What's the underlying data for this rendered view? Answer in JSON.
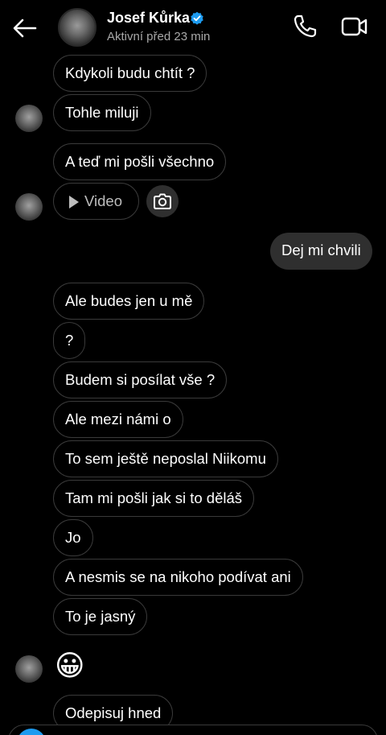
{
  "header": {
    "contact_name": "Josef Kůrka",
    "status": "Aktivní před 23 min",
    "verified_color": "#1d9bf0"
  },
  "messages": [
    {
      "dir": "in",
      "text": "Kdykoli budu chtít ?"
    },
    {
      "dir": "in",
      "text": "Tohle miluji"
    },
    {
      "dir": "in",
      "text": "A teď mi pošli všechno"
    },
    {
      "dir": "in",
      "type": "video",
      "text": "Video"
    },
    {
      "dir": "out",
      "text": "Dej mi chvili"
    },
    {
      "dir": "in",
      "text": "Ale budes jen u mě"
    },
    {
      "dir": "in",
      "text": "?"
    },
    {
      "dir": "in",
      "text": "Budem si posílat vše ?"
    },
    {
      "dir": "in",
      "text": "Ale mezi námi o"
    },
    {
      "dir": "in",
      "text": "To sem ještě neposlal Niikomu"
    },
    {
      "dir": "in",
      "text": "Tam mi pošli jak si to děláš"
    },
    {
      "dir": "in",
      "text": "Jo"
    },
    {
      "dir": "in",
      "text": "A nesmis se na nikoho podívat ani"
    },
    {
      "dir": "in",
      "text": "To je jasný"
    },
    {
      "dir": "in",
      "type": "emoji",
      "text": "😀"
    },
    {
      "dir": "in",
      "text": "Odepisuj hned"
    }
  ],
  "icons": {
    "back": "arrow-left-icon",
    "call": "phone-icon",
    "video_call": "video-camera-icon",
    "camera": "camera-icon",
    "verified": "verified-badge-icon"
  },
  "colors": {
    "background": "#000000",
    "outgoing_bubble": "#2f2f2f",
    "incoming_border": "#3a3a3a"
  }
}
